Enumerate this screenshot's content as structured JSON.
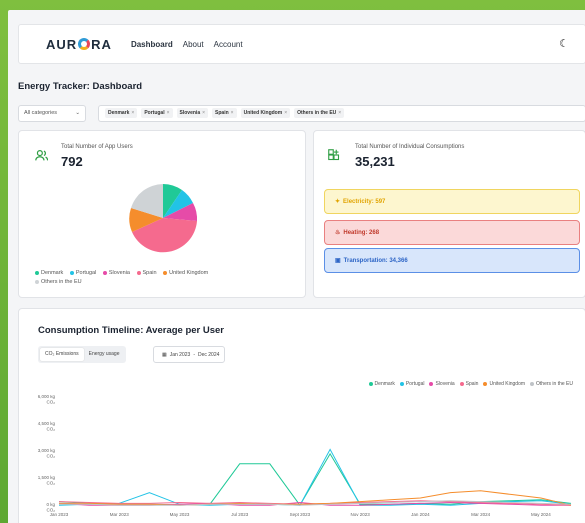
{
  "app": {
    "logo": "AURORA",
    "nav": [
      "Dashboard",
      "About",
      "Account"
    ]
  },
  "page": {
    "title": "Energy Tracker: Dashboard"
  },
  "filters": {
    "category_select": "All categories",
    "countries": [
      "Denmark",
      "Portugal",
      "Slovenia",
      "Spain",
      "United Kingdom",
      "Others in the EU"
    ]
  },
  "users_card": {
    "label": "Total Number of App Users",
    "value": "792",
    "legend": [
      {
        "name": "Denmark",
        "color": "#20c997"
      },
      {
        "name": "Portugal",
        "color": "#22c3e6"
      },
      {
        "name": "Slovenia",
        "color": "#e64ba8"
      },
      {
        "name": "Spain",
        "color": "#f56a8e"
      },
      {
        "name": "United Kingdom",
        "color": "#f58d2c"
      },
      {
        "name": "Others in the EU",
        "color": "#cfd3d6"
      }
    ]
  },
  "consumptions_card": {
    "label": "Total Number of Individual Consumptions",
    "value": "35,231",
    "categories": [
      {
        "label": "Electricity: 597"
      },
      {
        "label": "Heating: 268"
      },
      {
        "label": "Transportation: 34,366"
      }
    ]
  },
  "timeline": {
    "title": "Consumption Timeline: Average per User",
    "toggle": [
      "CO₂ Emissions",
      "Energy usage"
    ],
    "date_from": "Jan 2023",
    "date_to": "Dec 2024"
  },
  "chart_data": {
    "type": "line",
    "x": [
      "Jan 2023",
      "Feb 2023",
      "Mar 2023",
      "Apr 2023",
      "May 2023",
      "Jun 2023",
      "Jul 2023",
      "Aug 2023",
      "Sept 2023",
      "Oct 2023",
      "Nov 2023",
      "Dec 2023",
      "Jan 2024",
      "Feb 2024",
      "Mar 2024",
      "Apr 2024",
      "May 2024",
      "Jun 2024"
    ],
    "x_tick_labels": [
      "Jan 2023",
      "Mar 2023",
      "May 2023",
      "Jul 2023",
      "Sept 2023",
      "Nov 2023",
      "Jan 2024",
      "Mar 2024",
      "May 2024"
    ],
    "y_tick_labels": [
      "0 kg CO₂",
      "1,500 kg CO₂",
      "3,000 kg CO₂",
      "4,500 kg CO₂",
      "6,000 kg CO₂"
    ],
    "ylim": [
      0,
      6000
    ],
    "legend_position": "top-right",
    "series": [
      {
        "name": "Denmark",
        "color": "#20c997",
        "values": [
          300,
          200,
          150,
          150,
          120,
          130,
          2400,
          2400,
          100,
          2950,
          150,
          150,
          200,
          150,
          300,
          350,
          400,
          200
        ]
      },
      {
        "name": "Portugal",
        "color": "#22c3e6",
        "values": [
          100,
          150,
          200,
          800,
          150,
          100,
          150,
          150,
          100,
          3200,
          100,
          100,
          150,
          100,
          200,
          300,
          350,
          150
        ]
      },
      {
        "name": "Slovenia",
        "color": "#e64ba8",
        "values": [
          200,
          100,
          100,
          100,
          150,
          200,
          100,
          100,
          250,
          100,
          100,
          150,
          200,
          250,
          200,
          150,
          100,
          100
        ]
      },
      {
        "name": "Spain",
        "color": "#f56a8e",
        "values": [
          300,
          250,
          200,
          200,
          250,
          200,
          250,
          200,
          150,
          200,
          250,
          300,
          350,
          300,
          250,
          200,
          150,
          100
        ]
      },
      {
        "name": "United Kingdom",
        "color": "#f58d2c",
        "values": [
          200,
          200,
          150,
          150,
          100,
          150,
          200,
          150,
          150,
          200,
          300,
          400,
          500,
          800,
          900,
          700,
          500,
          100
        ]
      },
      {
        "name": "Others in the EU",
        "color": "#bfc3c7",
        "values": [
          150,
          150,
          100,
          100,
          100,
          150,
          150,
          150,
          100,
          150,
          200,
          250,
          300,
          350,
          300,
          250,
          200,
          150
        ]
      }
    ]
  }
}
